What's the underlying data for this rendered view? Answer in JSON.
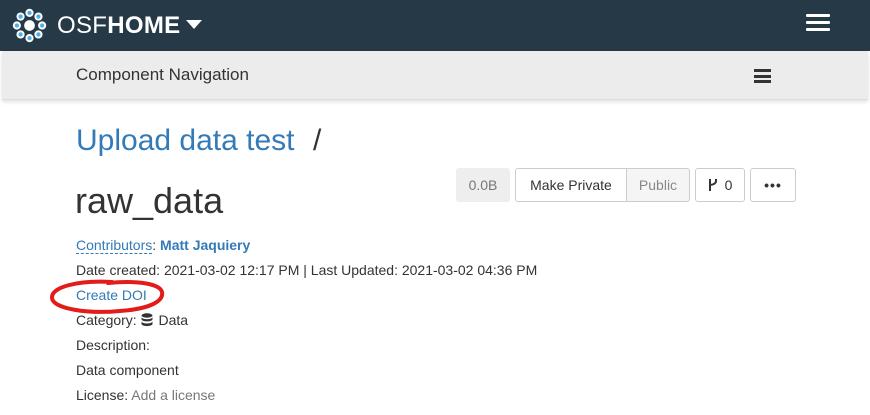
{
  "navbar": {
    "brand_osf": "OSF",
    "brand_home": "HOME",
    "logo_icon": "osf-flower-icon",
    "menu_icon": "hamburger-icon",
    "background": "#263947"
  },
  "component_nav": {
    "title": "Component Navigation",
    "menu_icon": "hamburger-icon"
  },
  "project": {
    "parent_title": "Upload data test",
    "separator": "/",
    "title": "raw_data"
  },
  "actions": {
    "size": "0.0B",
    "make_private": "Make Private",
    "public": "Public",
    "fork_count": "0",
    "more": "•••"
  },
  "meta": {
    "contributors_label": "Contributors",
    "contributors_sep": ":",
    "contributor_name": "Matt Jaquiery",
    "date_line": "Date created: 2021-03-02 12:17 PM | Last Updated: 2021-03-02 04:36 PM",
    "create_doi": "Create DOI",
    "category_label": "Category:",
    "category_value": "Data",
    "description_label": "Description:",
    "description_value": "Data component",
    "license_label": "License:",
    "license_value": "Add a license"
  },
  "colors": {
    "link": "#337ab7",
    "annotation": "#e21b1b"
  }
}
